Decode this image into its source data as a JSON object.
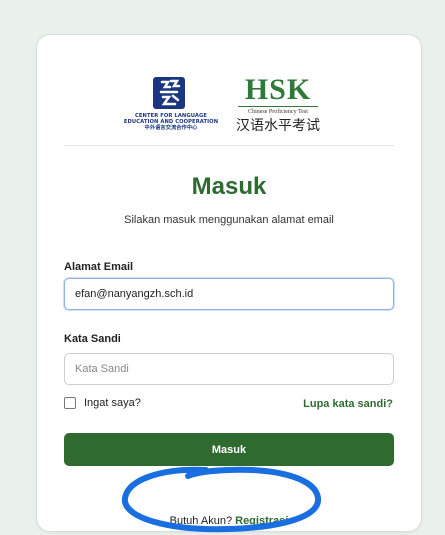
{
  "logos": {
    "clec_text_lines": [
      "CENTER FOR LANGUAGE",
      "EDUCATION AND COOPERATION",
      "中外语言交流合作中心"
    ],
    "hsk_title": "HSK",
    "hsk_subtitle": "Chinese Proficiency Test",
    "hsk_chinese": "汉语水平考试"
  },
  "login": {
    "title": "Masuk",
    "subtitle": "Silakan masuk menggunakan alamat email",
    "email_label": "Alamat Email",
    "email_value": "efan@nanyangzh.sch.id",
    "password_label": "Kata Sandi",
    "password_placeholder": "Kata Sandi",
    "remember_label": "Ingat saya?",
    "forgot_link": "Lupa kata sandi?",
    "submit_label": "Masuk",
    "register_prompt": "Butuh Akun?",
    "register_link": "Registrasi"
  },
  "colors": {
    "brand_green": "#2e6b30",
    "button_green": "#2f6b2f",
    "annotation_blue": "#1a6fe0",
    "logo_blue": "#1a3680"
  },
  "icons": [
    "clec-logo-icon",
    "checkbox-icon"
  ]
}
